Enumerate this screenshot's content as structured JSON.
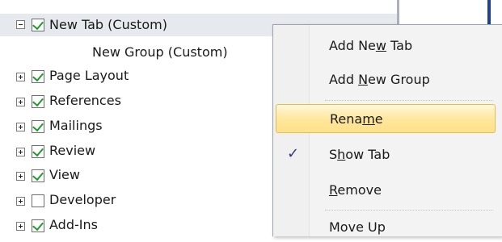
{
  "tree": {
    "rows": [
      {
        "expander": "minus",
        "checked": true,
        "label": "New Tab (Custom)",
        "selected": true
      },
      {
        "group_label": "New Group (Custom)"
      },
      {
        "expander": "plus",
        "checked": true,
        "label": "Page Layout"
      },
      {
        "expander": "plus",
        "checked": true,
        "label": "References"
      },
      {
        "expander": "plus",
        "checked": true,
        "label": "Mailings"
      },
      {
        "expander": "plus",
        "checked": true,
        "label": "Review"
      },
      {
        "expander": "plus",
        "checked": true,
        "label": "View"
      },
      {
        "expander": "plus",
        "checked": false,
        "label": "Developer"
      },
      {
        "expander": "plus",
        "checked": true,
        "label": "Add-Ins"
      }
    ]
  },
  "context_menu": {
    "items": [
      {
        "label": "Add New Tab",
        "mnemonic": "w"
      },
      {
        "label": "Add New Group",
        "mnemonic": "N"
      },
      {
        "label": "Rename",
        "mnemonic": "m",
        "highlighted": true
      },
      {
        "label": "Show Tab",
        "mnemonic": "h",
        "checked": true,
        "check_glyph": "✓"
      },
      {
        "label": "Remove",
        "mnemonic": "R"
      },
      {
        "label": "Move Up",
        "mnemonic": ""
      }
    ]
  },
  "colors": {
    "checkmark": "#1f9a2c",
    "highlight_border": "#e3bd4f",
    "highlight_fill": "#ffe69a",
    "accent_blue": "#1e3f9a"
  }
}
